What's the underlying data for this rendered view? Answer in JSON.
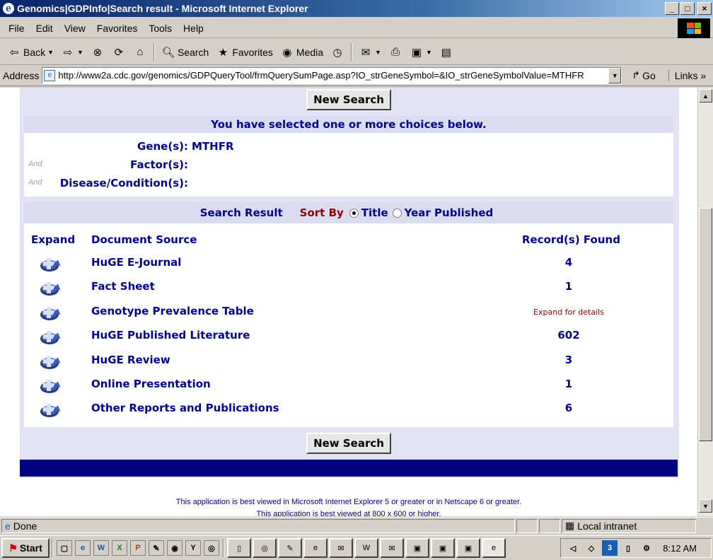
{
  "window": {
    "title": "Genomics|GDPInfo|Search result - Microsoft Internet Explorer",
    "minimize": "_",
    "restore": "□",
    "close": "×"
  },
  "menu": [
    "File",
    "Edit",
    "View",
    "Favorites",
    "Tools",
    "Help"
  ],
  "toolbar": {
    "back": "Back",
    "search": "Search",
    "favorites": "Favorites",
    "media": "Media"
  },
  "address": {
    "label": "Address",
    "url": "http://www2a.cdc.gov/genomics/GDPQueryTool/frmQuerySumPage.asp?IO_strGeneSymbol=&IO_strGeneSymbolValue=MTHFR",
    "go": "Go",
    "links": "Links »"
  },
  "page": {
    "new_search": "New Search",
    "choices_header": "You have selected one or more choices below.",
    "criteria": [
      {
        "and": "",
        "label": "Gene(s):",
        "value": "MTHFR"
      },
      {
        "and": "And",
        "label": "Factor(s):",
        "value": ""
      },
      {
        "and": "And",
        "label": "Disease/Condition(s):",
        "value": ""
      }
    ],
    "results_header": "Search Result",
    "sort_by": "Sort By",
    "sort_options": [
      {
        "label": "Title",
        "selected": true
      },
      {
        "label": "Year Published",
        "selected": false
      }
    ],
    "columns": {
      "expand": "Expand",
      "source": "Document Source",
      "records": "Record(s) Found"
    },
    "results": [
      {
        "source": "HuGE E-Journal",
        "records": "4"
      },
      {
        "source": "Fact Sheet",
        "records": "1"
      },
      {
        "source": "Genotype Prevalence Table",
        "records": "Expand for details"
      },
      {
        "source": "HuGE Published Literature",
        "records": "602"
      },
      {
        "source": "HuGE Review",
        "records": "3"
      },
      {
        "source": "Online Presentation",
        "records": "1"
      },
      {
        "source": "Other Reports and Publications",
        "records": "6"
      }
    ],
    "footer": "This application is best viewed in Microsoft Internet Explorer 5 or greater or in Netscape 6 or greater.",
    "footer2": "This application is best viewed at 800 x 600 or higher."
  },
  "status": {
    "text": "Done",
    "zone": "Local intranet"
  },
  "taskbar": {
    "start": "Start",
    "clock": "8:12 AM"
  },
  "colors": {
    "link_blue": "#00008b",
    "accent_red": "#8b0000",
    "panel": "#e3e3f5",
    "header_band": "#dcdcf0",
    "bar": "#000080"
  }
}
